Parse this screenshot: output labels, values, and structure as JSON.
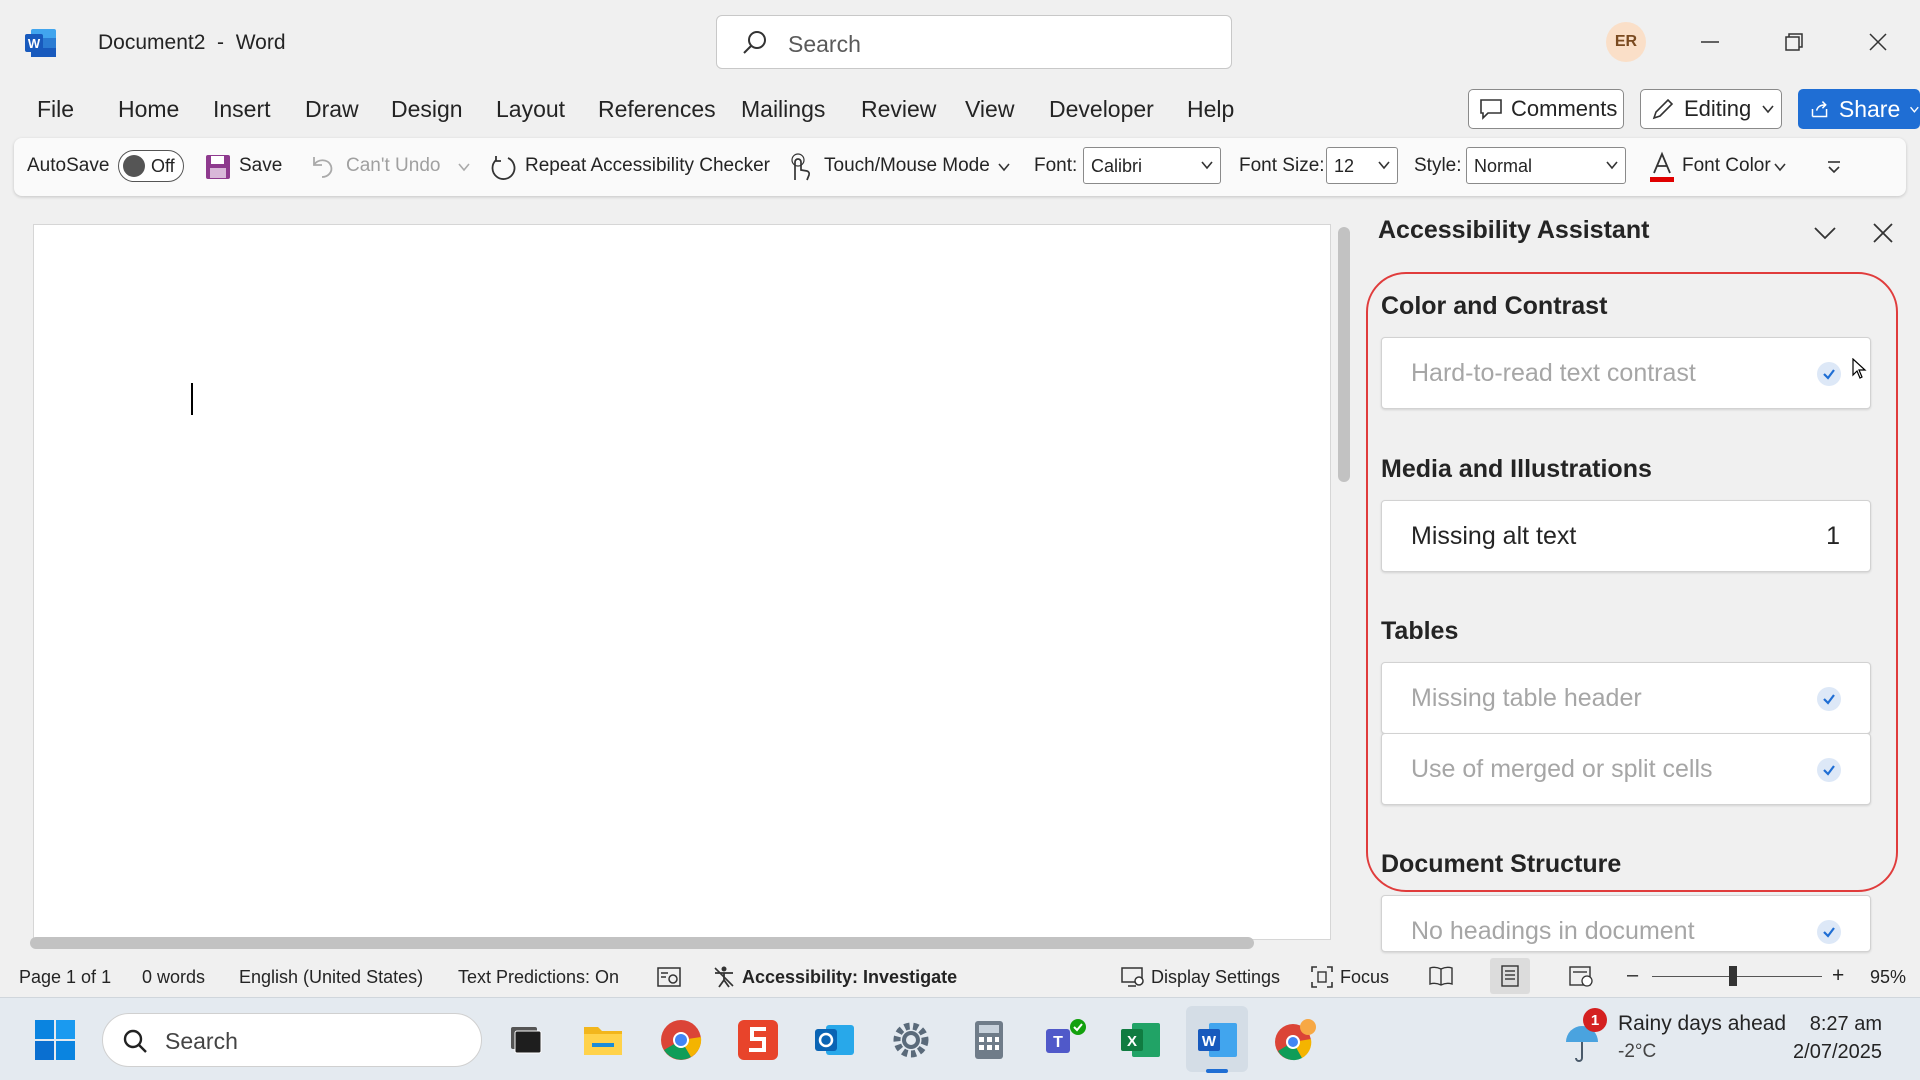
{
  "titlebar": {
    "doc_title": "Document2  -  Word",
    "search_placeholder": "Search",
    "avatar_initials": "ER"
  },
  "menu": {
    "tabs": [
      "File",
      "Home",
      "Insert",
      "Draw",
      "Design",
      "Layout",
      "References",
      "Mailings",
      "Review",
      "View",
      "Developer",
      "Help"
    ],
    "comments_label": "Comments",
    "editing_label": "Editing",
    "share_label": "Share"
  },
  "toolbar": {
    "autosave_label": "AutoSave",
    "autosave_state": "Off",
    "save_label": "Save",
    "undo_label": "Can't Undo",
    "repeat_label": "Repeat Accessibility Checker",
    "touch_label": "Touch/Mouse Mode",
    "font_label": "Font:",
    "font_value": "Calibri",
    "fontsize_label": "Font Size:",
    "fontsize_value": "12",
    "style_label": "Style:",
    "style_value": "Normal",
    "fontcolor_label": "Font Color"
  },
  "pane": {
    "title": "Accessibility Assistant",
    "sections": {
      "color": {
        "title": "Color and Contrast",
        "items": [
          {
            "label": "Hard-to-read text contrast",
            "state": "checked"
          }
        ]
      },
      "media": {
        "title": "Media and Illustrations",
        "items": [
          {
            "label": "Missing alt text",
            "count": "1"
          }
        ]
      },
      "tables": {
        "title": "Tables",
        "items": [
          {
            "label": "Missing table header",
            "state": "checked"
          },
          {
            "label": "Use of merged or split cells",
            "state": "checked"
          }
        ]
      },
      "structure": {
        "title": "Document Structure",
        "items": [
          {
            "label": "No headings in document",
            "state": "checked"
          }
        ]
      }
    }
  },
  "statusbar": {
    "page": "Page 1 of 1",
    "words": "0 words",
    "language": "English (United States)",
    "predictions": "Text Predictions: On",
    "accessibility": "Accessibility: Investigate",
    "display_settings": "Display Settings",
    "focus": "Focus",
    "zoom": "95%",
    "zoom_minus": "–",
    "zoom_plus": "+"
  },
  "taskbar": {
    "search_placeholder": "Search",
    "weather_badge": "1",
    "weather_line1": "Rainy days ahead",
    "weather_line2": "-2°C",
    "time": "8:27 am",
    "date": "2/07/2025"
  },
  "colors": {
    "accent": "#1f6ed4",
    "highlight": "#e03c3c",
    "check": "#1f6ed4",
    "word_blue": "#185abd"
  }
}
